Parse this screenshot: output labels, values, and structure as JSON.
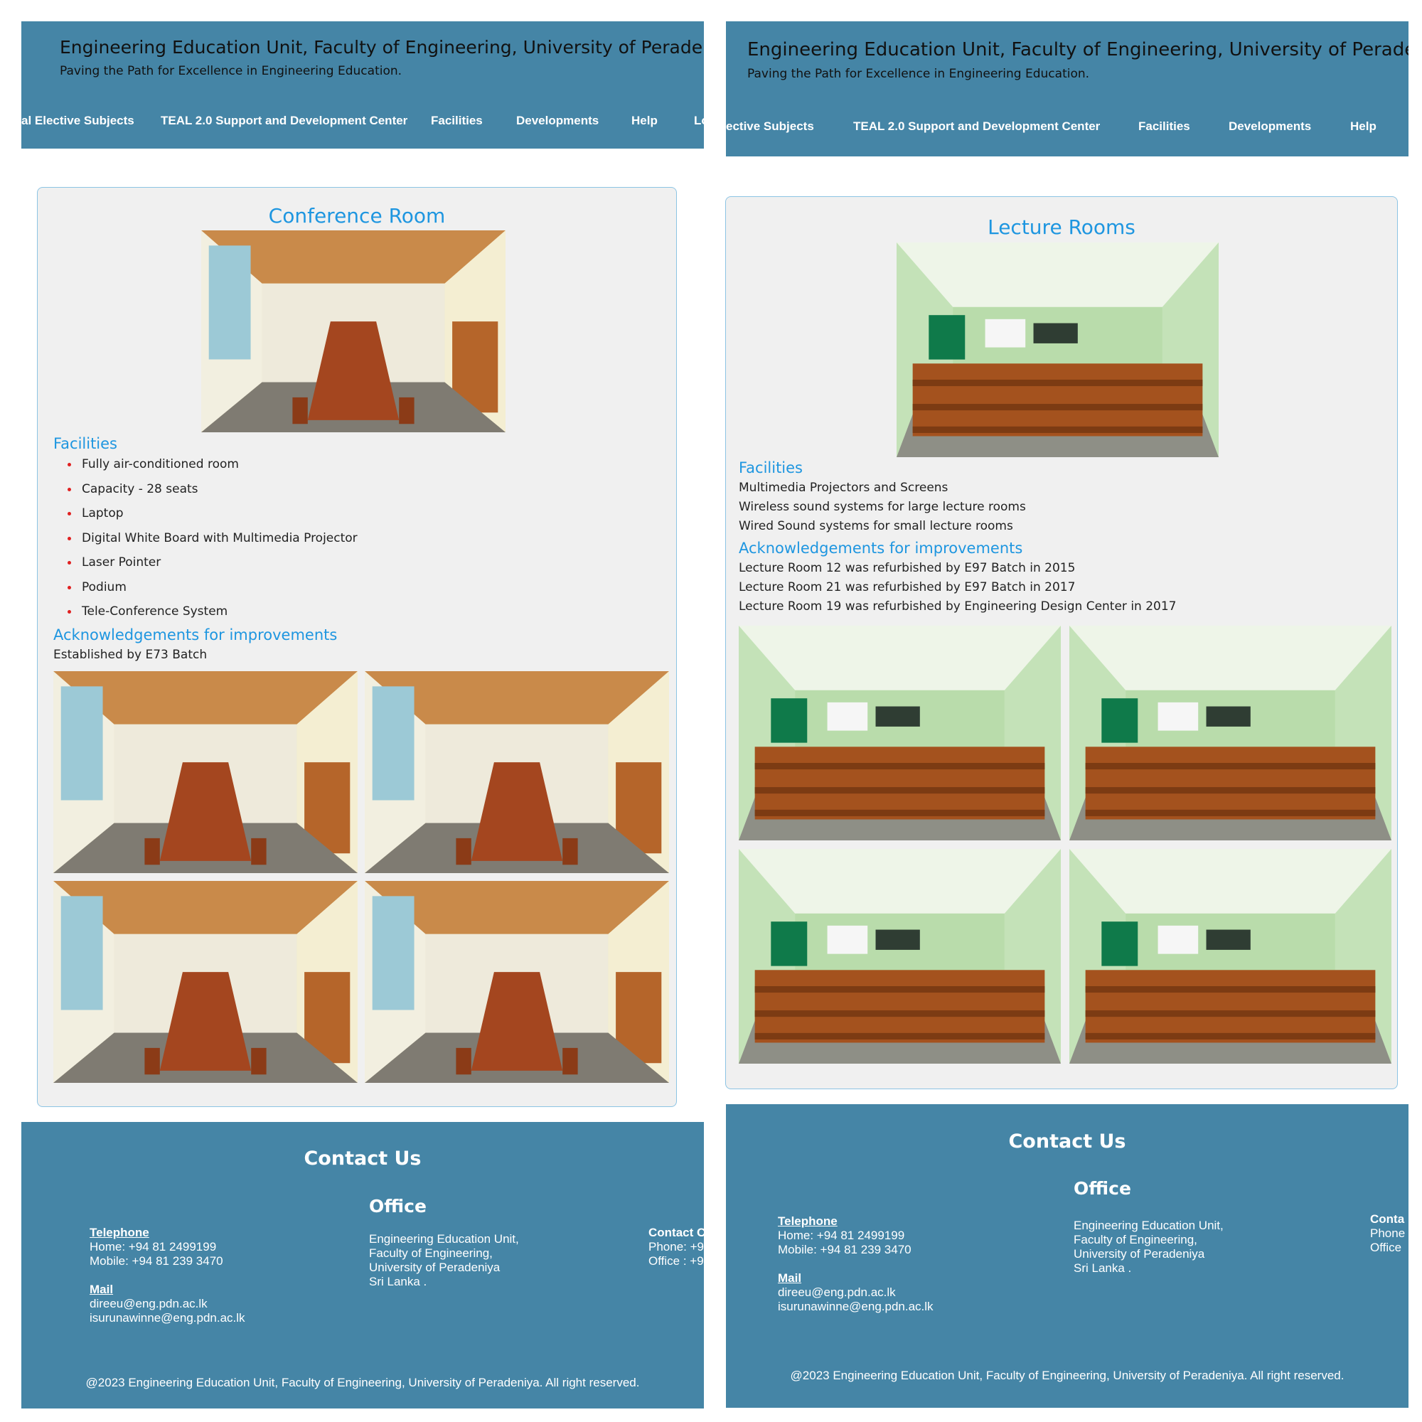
{
  "header": {
    "title": "Engineering Education Unit, Faculty of Engineering, University of Peradeniya",
    "tagline": "Paving the Path for Excellence in Engineering Education."
  },
  "left_panel": {
    "nav": [
      "al Elective Subjects",
      "TEAL 2.0 Support and Development Center",
      "Facilities",
      "Developments",
      "Help",
      "Lo"
    ],
    "card_title": "Conference Room",
    "facilities_heading": "Facilities",
    "facilities": [
      "Fully air-conditioned room",
      "Capacity - 28 seats",
      "Laptop",
      "Digital White Board with Multimedia Projector",
      "Laser Pointer",
      "Podium",
      "Tele-Conference System"
    ],
    "ack_heading": "Acknowledgements for improvements",
    "ack_text": "Established by E73 Batch"
  },
  "right_panel": {
    "nav": [
      "ective Subjects",
      "TEAL 2.0 Support and Development Center",
      "Facilities",
      "Developments",
      "Help"
    ],
    "card_title": "Lecture Rooms",
    "facilities_heading": "Facilities",
    "facilities": [
      "Multimedia Projectors and Screens",
      "Wireless sound systems for large lecture rooms",
      "Wired Sound systems for small lecture rooms"
    ],
    "ack_heading": "Acknowledgements for improvements",
    "acks": [
      "Lecture Room 12 was refurbished by E97 Batch in 2015",
      "Lecture Room 21 was refurbished by E97 Batch in 2017",
      "Lecture Room 19 was refurbished by Engineering Design Center in 2017"
    ]
  },
  "footer": {
    "contact_title": "Contact Us",
    "office_title": "Office",
    "telephone_label": "Telephone",
    "home": "Home: +94 81 2499199",
    "mobile": "Mobile: +94 81 239 3470",
    "mail_label": "Mail",
    "email1": "direeu@eng.pdn.ac.lk",
    "email2": "isurunawinne@eng.pdn.ac.lk",
    "office_lines": [
      "Engineering Education Unit,",
      "Faculty of Engineering,",
      "University of Peradeniya",
      "Sri Lanka ."
    ],
    "contact_left": {
      "title": "Contact C",
      "phone": "Phone: +9",
      "office": "Office : +9"
    },
    "contact_right": {
      "title": "Conta",
      "phone": "Phone",
      "office": "Office"
    },
    "copyright": "@2023 Engineering Education Unit, Faculty of Engineering, University of Peradeniya. All right reserved."
  },
  "colors": {
    "header_bg": "#4585a6",
    "accent": "#1e96e0",
    "card_bg": "#f0f0f0",
    "bullet": "#e02020"
  }
}
